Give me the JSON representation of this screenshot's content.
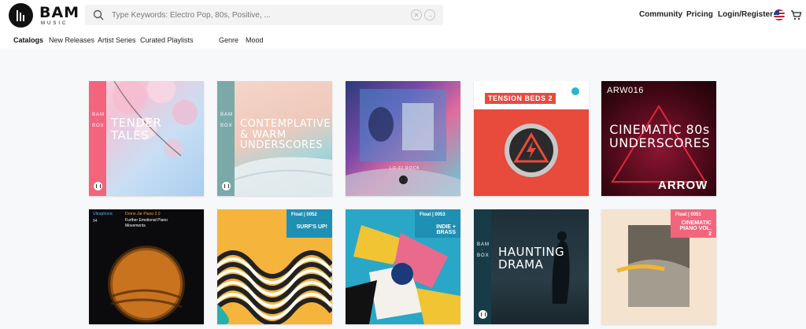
{
  "brand": {
    "name": "BAM",
    "sub": "MUSIC"
  },
  "search": {
    "placeholder": "Type Keywords: Electro Pop, 80s, Positive, ..."
  },
  "header_nav": {
    "community": "Community",
    "pricing": "Pricing",
    "login": "Login/Register"
  },
  "subnav": [
    "Catalogs",
    "New Releases",
    "Artist Series",
    "Curated Playlists",
    "Genre",
    "Mood"
  ],
  "colors": {
    "accent_pink": "#f2657c",
    "teal": "#1f8fb3",
    "red": "#e84a3c",
    "brand_dark": "#111111"
  },
  "albums": [
    {
      "title": "TENDER TALES",
      "series": "BAM · BOX"
    },
    {
      "title": "CONTEMPLATIVE & WARM UNDERSCORES",
      "series": "BAM · BOX"
    },
    {
      "title": "",
      "series": "LO-FI ROCK"
    },
    {
      "title": "TENSION BEDS 2",
      "series": ""
    },
    {
      "title": "CINEMATIC 80s UNDERSCORES",
      "series": "ARW016",
      "brand": "ARROW"
    },
    {
      "title": "Further Emotional Piano Movements",
      "series": "Ultraphonic",
      "sub": "Drone Jar Piano 2.0",
      "num": "94"
    },
    {
      "title": "SURF'S UP!",
      "series": "Float",
      "num": "0052"
    },
    {
      "title": "INDIE + BRASS",
      "series": "Float",
      "num": "0053"
    },
    {
      "title": "HAUNTING DRAMA",
      "series": "BAM · BOX"
    },
    {
      "title": "CINEMATIC PIANO VOL. 2",
      "series": "Float",
      "num": "0051"
    }
  ]
}
